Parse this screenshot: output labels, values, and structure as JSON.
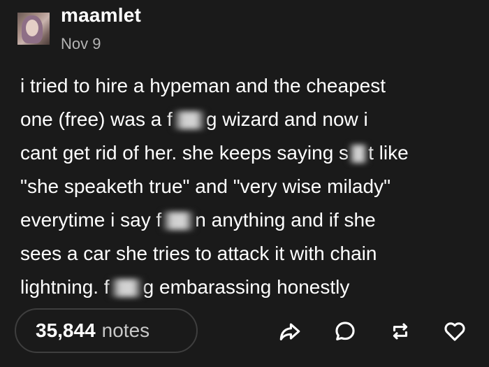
{
  "post": {
    "username": "maamlet",
    "date": "Nov 9",
    "lines": [
      {
        "a": "i tried to hire a hypeman and the cheapest"
      },
      {
        "a": "one (free) was a f",
        "b": "g wizard and now i"
      },
      {
        "a": "cant get rid of her. she keeps saying s",
        "b": "t like"
      },
      {
        "a": "\"she speaketh true\" and \"very wise milady\""
      },
      {
        "a": "everytime i say f",
        "b": "n anything and if she"
      },
      {
        "a": "sees a car she tries to attack it with chain"
      },
      {
        "a": "lightning. f",
        "b": "g embarassing honestly"
      }
    ]
  },
  "footer": {
    "notes_count": "35,844",
    "notes_label": "notes",
    "icons": [
      "share-icon",
      "reply-icon",
      "reblog-icon",
      "like-icon"
    ]
  }
}
